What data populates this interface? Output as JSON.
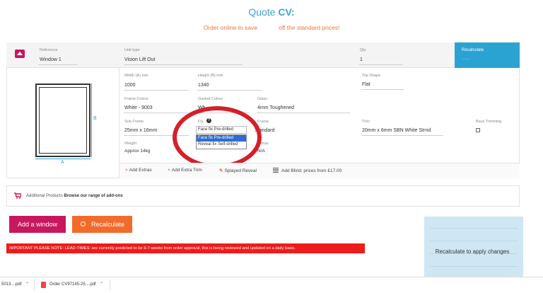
{
  "page": {
    "title_prefix": "Quote",
    "title_code": "CV:",
    "subtitle_left": "Order online to save",
    "subtitle_right": "off the standard prices!"
  },
  "window_header": {
    "reference_label": "Reference",
    "reference_value": "Window 1",
    "unit_type_label": "Unit type",
    "unit_type_value": "Vision Lift Out",
    "qty_label": "Qty",
    "qty_value": "1",
    "recalculate_label": "Recalculate",
    "recalculate_sub": "—  —"
  },
  "diagram": {
    "width_marker": "A",
    "height_marker": "B"
  },
  "fields": {
    "width_label": "Width (A) mm",
    "width_value": "1000",
    "height_label": "Height (B) mm",
    "height_value": "1340",
    "top_shape_label": "Top Shape",
    "top_shape_value": "Flat",
    "frame_colour_label": "Frame Colour",
    "frame_colour_value": "White - 9003",
    "gasket_colour_label": "Gasket Colour",
    "gasket_colour_value": "Wh",
    "glass_label": "Glass",
    "glass_value": "4mm Toughened",
    "sub_frame_label": "Sub Frame",
    "sub_frame_value": "25mm x 16mm",
    "fix_label": "Fix",
    "fix_value": "Face fix Pre-drilled",
    "frame_label": "Frame",
    "frame_value": "Standard",
    "trim_label": "Trim",
    "trim_value": "20mm x 6mm SBN White Strnd",
    "back_trimming_label": "Back Trimming",
    "weight_label": "Weight",
    "weight_value": "Approx 14kg",
    "extras_label": "Extras",
    "extras_value": "N/A"
  },
  "fix_dropdown": {
    "options": [
      "Face fix Pre-drilled",
      "Reveal fix Self-drilled"
    ],
    "selected_index": 0
  },
  "extras_bar": {
    "add_extras": "Add Extras",
    "add_extra_trim": "Add Extra Trim",
    "splayed_reveal": "Splayed Reveal",
    "add_blind": "Add Blind: prices from £17.00"
  },
  "additional_products": {
    "label": "Additional Products",
    "link": "Browse our range of add-ons"
  },
  "actions": {
    "add_window": "Add a window",
    "recalculate": "Recalculate"
  },
  "notice": "IMPORTANT PLEASE NOTE: LEAD-TIMES: are currently predicted to be 6-7-weeks from order approval, this is being reviewed and updated on a daily basis.",
  "totals": {
    "message": "Recalculate to apply changes"
  },
  "downloads": [
    {
      "name": "5013....pdf"
    },
    {
      "name": "Order CV97145-25....pdf"
    }
  ],
  "colors": {
    "accent_blue": "#2aa3d3",
    "brand_pink": "#c8175d",
    "orange": "#f26b2a",
    "notice_red": "#ee1c1c",
    "highlight_ring": "#d4202a"
  }
}
